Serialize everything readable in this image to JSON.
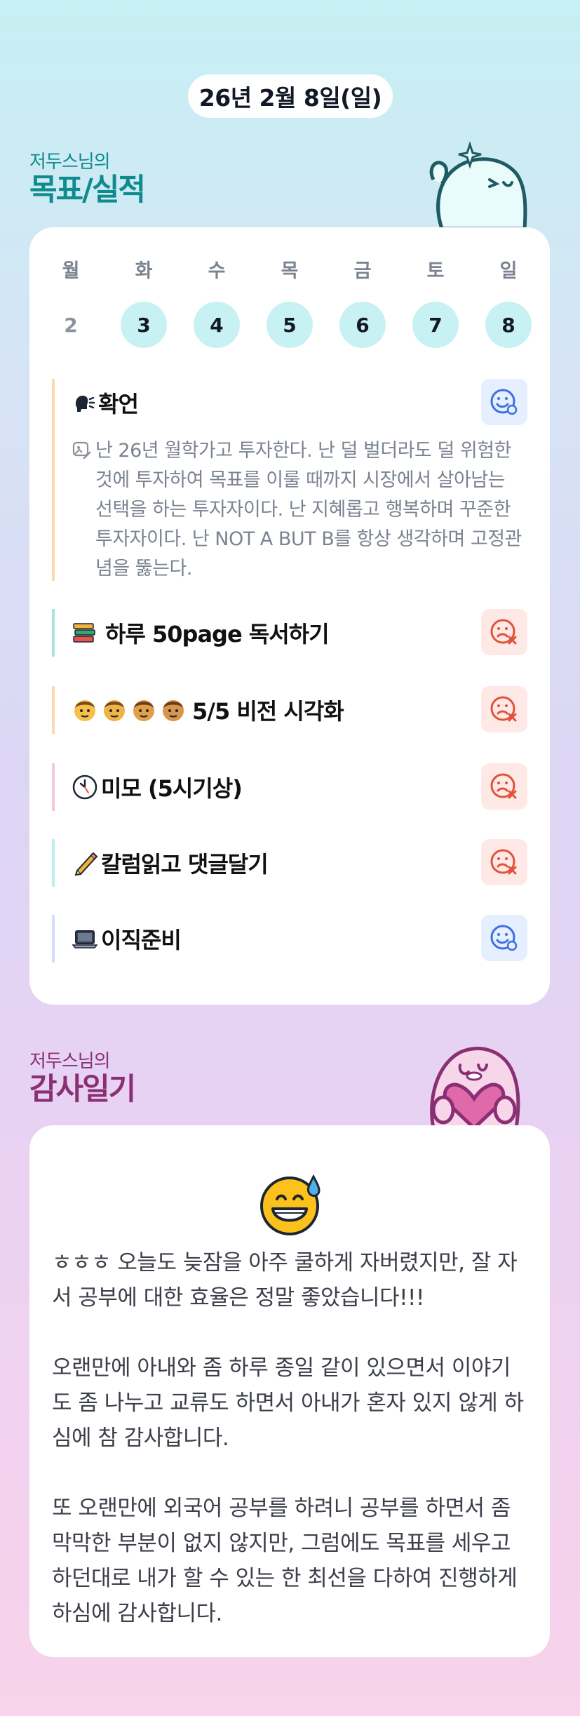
{
  "header": {
    "date": "26년 2월 8일(일)"
  },
  "goals_section": {
    "subtitle": "저두스님의",
    "title": "목표/실적"
  },
  "week": [
    {
      "label": "월",
      "num": "2",
      "done": false
    },
    {
      "label": "화",
      "num": "3",
      "done": true
    },
    {
      "label": "수",
      "num": "4",
      "done": true
    },
    {
      "label": "목",
      "num": "5",
      "done": true
    },
    {
      "label": "금",
      "num": "6",
      "done": true
    },
    {
      "label": "토",
      "num": "7",
      "done": true
    },
    {
      "label": "일",
      "num": "8",
      "done": true
    }
  ],
  "affirmation": {
    "title": "확언",
    "icon": "speaking-head-icon",
    "status": "achieved",
    "text": "난 26년 월학가고 투자한다. 난 덜 벌더라도 덜 위험한 것에 투자하여 목표를 이룰 때까지 시장에서 살아남는 선택을 하는 투자자이다. 난 지혜롭고 행복하며 꾸준한 투자자이다. 난 NOT A BUT B를 항상 생각하며 고정관념을 뚫는다."
  },
  "goals": [
    {
      "title": "하루 50page 독서하기",
      "icon": "books-icon",
      "status": "failed",
      "color": "#a7e6e0"
    },
    {
      "title": "5/5 비전 시각화",
      "icon": "boy-faces-icon",
      "status": "failed",
      "color": "#ffd7ae"
    },
    {
      "title": "미모 (5시기상)",
      "icon": "clock-icon",
      "status": "failed",
      "color": "#f8c5e2"
    },
    {
      "title": "칼럼읽고 댓글달기",
      "icon": "pencil-icon",
      "status": "failed",
      "color": "#bfeef0"
    },
    {
      "title": "이직준비",
      "icon": "laptop-icon",
      "status": "achieved",
      "color": "#d5dcf5"
    }
  ],
  "thanks_section": {
    "subtitle": "저두스님의",
    "title": "감사일기",
    "emoji": "grinning-sweat-face-icon",
    "paragraphs": [
      "ㅎㅎㅎ 오늘도 늦잠을 아주 쿨하게 자버렸지만, 잘 자서 공부에 대한 효율은 정말 좋았습니다!!!",
      "오랜만에 아내와 좀 하루 종일 같이 있으면서 이야기도 좀 나누고 교류도 하면서 아내가 혼자 있지 않게 하심에 참 감사합니다.",
      "또 오랜만에 외국어 공부를 하려니 공부를 하면서 좀 막막한 부분이 없지 않지만, 그럼에도 목표를 세우고 하던대로 내가 할 수 있는 한 최선을 다하여 진행하게 하심에 감사합니다."
    ]
  },
  "colors": {
    "teal": "#0f8b8d",
    "plum": "#8a2f73",
    "done_day": "#c8f1f3",
    "ok_icon": "#3d6fe0",
    "bad_icon": "#e0523b"
  }
}
